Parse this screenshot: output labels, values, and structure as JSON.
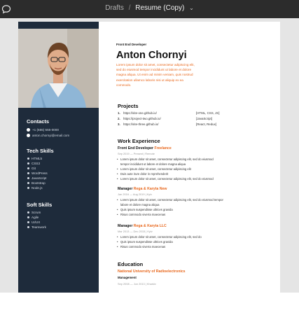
{
  "toolbar": {
    "breadcrumb_parent": "Drafts",
    "breadcrumb_separator": "/",
    "file_name": "Resume (Copy)",
    "menu_chevron": "⌄"
  },
  "colors": {
    "sidebar": "#1e2b3b",
    "accent": "#e8671c",
    "topbar": "#2c2c2c",
    "canvas": "#e5e5e5"
  },
  "resume": {
    "role_label": "Front End Developer",
    "name": "Anton Chornyi",
    "intro_lines": [
      "Lorem ipsum dolor sit amet, consectetur adipiscing elit,",
      "sed do eiusmod tempor incididunt ut labore et dolore",
      "magna aliqua. Ut enim ad minim veniam, quis nostrud",
      "exercitation ullamco laboris nisi ut aliquip ex ea",
      "commodo."
    ],
    "sidebar": {
      "contacts_heading": "Contacts",
      "contacts": [
        "+1 (555) 555-0000",
        "anton.chornyi@email.com"
      ],
      "tech_heading": "Tech Skills",
      "tech_skills": [
        "HTML5",
        "CSS3",
        "Git",
        "WordPress",
        "JavaScript",
        "Bootstrap",
        "Node.js"
      ],
      "soft_heading": "Soft Skills",
      "soft_skills": [
        "Scrum",
        "Agile",
        "UI/UX",
        "Teamwork"
      ]
    },
    "projects": {
      "heading": "Projects",
      "items": [
        {
          "num": "1.",
          "text": "https://site-one.github.io/",
          "tag": "[HTML, CSS, JS]"
        },
        {
          "num": "2.",
          "text": "https://project-two.github.io/",
          "tag": "[JavaScript]"
        },
        {
          "num": "3.",
          "text": "https://site-three.github.io/",
          "tag": "[React, Redux]"
        }
      ]
    },
    "experience": {
      "heading": "Work Experience",
      "jobs": [
        {
          "title": "Front End Developer",
          "company": "Freelance",
          "meta": "Sep 2019 — Present  |  Remote",
          "bullets": [
            "Lorem ipsum dolor sit amet, consectetur adipiscing elit, sed do eiusmod",
            "tempor incididunt ut labore et dolore magna aliqua",
            "Lorem ipsum dolor sit amet, consectetur adipiscing elit",
            "Duis aute irure dolor in reprehenderit",
            "Lorem ipsum dolor sit amet, consectetur adipiscing elit, sed do eiusmod"
          ]
        },
        {
          "title": "Manager",
          "company": "Rega & Karyta New",
          "meta": "Jan 2016 — Aug 2019  |  Kyiv",
          "bullets": [
            "Lorem ipsum dolor sit amet, consectetur adipiscing elit, sed do eiusmod tempor",
            "labore et dolore magna aliqua",
            "Quis ipsum suspendisse ultrices gravida",
            "Risus commodo viverra maecenas"
          ]
        },
        {
          "title": "Manager",
          "company": "Rega & Karyta LLC",
          "meta": "Mar 2013 — Dec 2015  |  Kyiv",
          "bullets": [
            "Lorem ipsum dolor sit amet, consectetur adipiscing elit, sed do",
            "Quis ipsum suspendisse ultrices gravida",
            "Risus commodo viverra maecenas"
          ]
        }
      ]
    },
    "education": {
      "heading": "Education",
      "school": "National University of Radioelectronics",
      "degree": "Management",
      "meta": "Sep 2008 — Jun 2013  |  Kharkiv"
    }
  }
}
